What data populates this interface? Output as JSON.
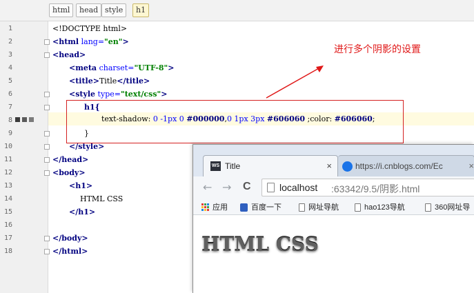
{
  "breadcrumbs": [
    "html",
    "head",
    "style",
    "h1"
  ],
  "line_numbers": [
    "1",
    "2",
    "3",
    "4",
    "5",
    "6",
    "7",
    "8",
    "9",
    "10",
    "11",
    "12",
    "13",
    "14",
    "15",
    "16",
    "17",
    "18"
  ],
  "code": {
    "l1": "<!DOCTYPE html>",
    "l2_open": "<",
    "l2_tag": "html",
    "l2_attr": " lang=",
    "l2_val": "\"en\"",
    "l2_close": ">",
    "l3": "<head>",
    "l4_tag": "<meta",
    "l4_attr": " charset=",
    "l4_val": "\"UTF-8\"",
    "l4_close": ">",
    "l5_open": "<title>",
    "l5_text": "Title",
    "l5_close": "</title>",
    "l6_tag": "<style",
    "l6_attr": " type=",
    "l6_val": "\"text/css\"",
    "l6_close": ">",
    "l7": "h1{",
    "l8_prop": "text-shadow: ",
    "l8_v1": "0 -1px 0 ",
    "l8_h1": "#000000",
    "l8_sep": ",",
    "l8_v2": "0 1px 3px ",
    "l8_h2": "#606060",
    "l8_mid": " ;color: ",
    "l8_h3": "#606060",
    "l8_end": ";",
    "l9": "}",
    "l10": "</style>",
    "l11": "</head>",
    "l12": "<body>",
    "l13": "<h1>",
    "l14": "HTML CSS",
    "l15": "</h1>",
    "l17": "</body>",
    "l18": "</html>"
  },
  "annotation": "进行多个阴影的设置",
  "browser": {
    "tab1_title": "Title",
    "tab1_favicon": "WS",
    "tab2_title": "https://i.cnblogs.com/Ec",
    "close_glyph": "×",
    "back_glyph": "←",
    "forward_glyph": "→",
    "reload_glyph": "C",
    "url_host": "localhost",
    "url_path": ":63342/9.5/阴影.html",
    "bookmarks": [
      "应用",
      "百度一下",
      "网址导航",
      "hao123导航",
      "360网址导"
    ],
    "heading": "HTML CSS"
  },
  "colors": {
    "annotation_red": "#e01818",
    "shadow_primary": "#000000",
    "text_color": "#606060"
  }
}
